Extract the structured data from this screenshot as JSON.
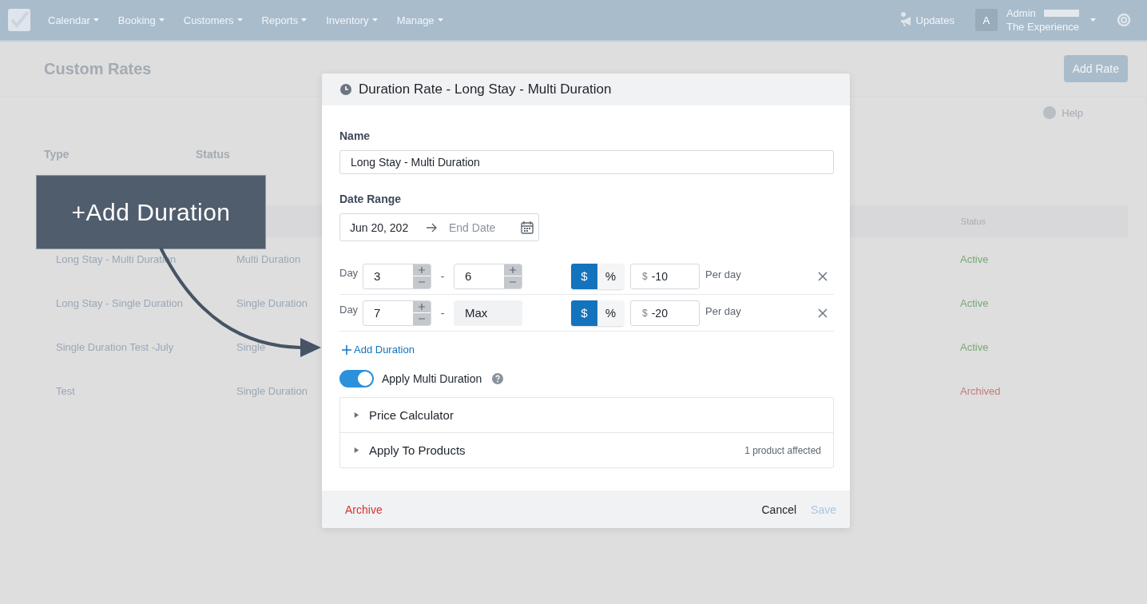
{
  "nav": {
    "items": [
      "Calendar",
      "Booking",
      "Customers",
      "Reports",
      "Inventory",
      "Manage"
    ],
    "updates": "Updates",
    "avatar": "A",
    "user": "Admin",
    "org": "The Experience"
  },
  "page": {
    "title": "Custom Rates",
    "add_button": "Add Rate",
    "help": "Help",
    "filters": [
      "Type",
      "Status"
    ],
    "table": {
      "status_heading": "Status",
      "rows": [
        {
          "name": "Long Stay - Multi Duration",
          "type": "Multi Duration",
          "status": "Active",
          "color": "#78a878"
        },
        {
          "name": "Long Stay - Single Duration",
          "type": "Single Duration",
          "status": "Active",
          "color": "#78a878"
        },
        {
          "name": "Single Duration Test -July",
          "type": "Single",
          "status": "Active",
          "color": "#78a878"
        },
        {
          "name": "Test",
          "type": "Single Duration",
          "status": "Archived",
          "color": "#c47a7a"
        }
      ]
    }
  },
  "modal": {
    "title": "Duration Rate - Long Stay - Multi Duration",
    "name_label": "Name",
    "name_value": "Long Stay - Multi Duration",
    "date_label": "Date Range",
    "start_date": "Jun 20, 202",
    "end_placeholder": "End Date",
    "durations": [
      {
        "label": "Day",
        "from": "3",
        "separator": "-",
        "to_max": false,
        "to": "6",
        "units": [
          {
            "label": "$",
            "selected": true
          },
          {
            "label": "%",
            "selected": false
          }
        ],
        "prefix": "$",
        "amount": "-10",
        "per": "Per day"
      },
      {
        "label": "Day",
        "from": "7",
        "separator": "-",
        "to_max": true,
        "to": "Max",
        "units": [
          {
            "label": "$",
            "selected": true
          },
          {
            "label": "%",
            "selected": false
          }
        ],
        "prefix": "$",
        "amount": "-20",
        "per": "Per day"
      }
    ],
    "add_duration": "Add Duration",
    "toggle": {
      "label": "Apply Multi Duration",
      "on": true
    },
    "sections": [
      {
        "title": "Price Calculator",
        "expanded": false
      },
      {
        "title": "Apply To Products",
        "note": "1 product affected",
        "expanded": false
      }
    ],
    "archive": "Archive",
    "cancel": "Cancel",
    "save": {
      "label": "Save",
      "disabled": true
    }
  },
  "annotation": {
    "text": "+Add Duration"
  }
}
